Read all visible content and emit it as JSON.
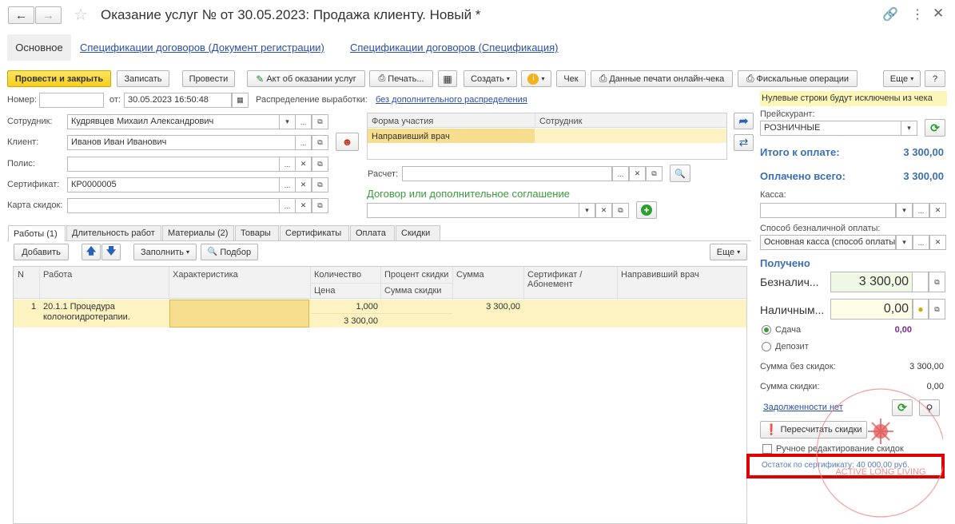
{
  "window": {
    "title": "Оказание услуг №  от 30.05.2023: Продажа клиенту.  Новый *"
  },
  "nav_tabs": {
    "main": "Основное",
    "spec_reg": "Спецификации договоров (Документ регистрации)",
    "spec": "Спецификации договоров (Спецификация)"
  },
  "toolbar": {
    "post_close": "Провести и закрыть",
    "write": "Записать",
    "post": "Провести",
    "act": "Акт об оказании услуг",
    "print": "Печать...",
    "create": "Создать",
    "check": "Чек",
    "online_print": "Данные печати онлайн-чека",
    "fiscal": "Фискальные операции",
    "more": "Еще",
    "help": "?"
  },
  "header": {
    "number_label": "Номер:",
    "number_value": "",
    "date_label": "от:",
    "date_value": "30.05.2023 16:50:48",
    "distribution_label": "Распределение выработки:",
    "distribution_value": "без дополнительного распределения",
    "zero_warning": "Нулевые строки будут исключены из чека"
  },
  "fields": {
    "employee_label": "Сотрудник:",
    "employee_value": "Кудрявцев Михаил Александрович",
    "client_label": "Клиент:",
    "client_value": "Иванов Иван Иванович",
    "policy_label": "Полис:",
    "policy_value": "",
    "certificate_label": "Сертификат:",
    "certificate_value": "КР0000005",
    "discount_card_label": "Карта скидок:",
    "discount_card_value": "",
    "calc_label": "Расчет:",
    "calc_value": "",
    "contract_label": "Договор или дополнительное соглашение",
    "contract_value": ""
  },
  "participation": {
    "col_form": "Форма участия",
    "col_employee": "Сотрудник",
    "row_form": "Направивший врач",
    "row_employee": ""
  },
  "tabs": [
    "Работы (1)",
    "Длительность работ",
    "Материалы (2)",
    "Товары",
    "Сертификаты",
    "Оплата",
    "Скидки"
  ],
  "table_toolbar": {
    "add": "Добавить",
    "fill": "Заполнить",
    "pick": "Подбор",
    "more": "Еще"
  },
  "table": {
    "headers": {
      "n": "N",
      "work": "Работа",
      "characteristic": "Характеристика",
      "qty": "Количество",
      "price": "Цена",
      "discount_pct": "Процент скидки",
      "discount_sum": "Сумма скидки",
      "sum": "Сумма",
      "cert": "Сертификат /",
      "cert2": "Абонемент",
      "doctor": "Направивший врач"
    },
    "rows": [
      {
        "n": "1",
        "work1": "20.1.1 Процедура",
        "work2": "колоногидротерапии.",
        "characteristic": "",
        "qty": "1,000",
        "price": "3 300,00",
        "discount_pct": "",
        "discount_sum": "",
        "sum": "3 300,00",
        "cert": "",
        "doctor": ""
      }
    ]
  },
  "right": {
    "pricelist_label": "Прейскурант:",
    "pricelist_value": "РОЗНИЧНЫЕ",
    "total_label": "Итого к оплате:",
    "total_value": "3 300,00",
    "paid_label": "Оплачено всего:",
    "paid_value": "3 300,00",
    "cashbox_label": "Касса:",
    "cashbox_value": "",
    "noncash_method_label": "Способ безналичной оплаты:",
    "noncash_method_value": "Основная касса (способ оплаты",
    "received_label": "Получено",
    "cashless_label": "Безналич...",
    "cashless_value": "3 300,00",
    "cash_label": "Наличным...",
    "cash_value": "0,00",
    "change_label": "Сдача",
    "change_value": "0,00",
    "deposit_label": "Депозит",
    "sum_no_disc_label": "Сумма без скидок:",
    "sum_no_disc_value": "3 300,00",
    "disc_sum_label": "Сумма скидки:",
    "disc_sum_value": "0,00",
    "no_debts": "Задолженности нет",
    "recalc": "Пересчитать скидки",
    "manual_edit": "Ручное редактирование скидок",
    "cert_balance": "Остаток по сертификату: 40 000,00 руб."
  },
  "watermark": {
    "text": "ACTIVE LONG LIVING"
  },
  "colors": {
    "accent_yellow": "#f6cf1a",
    "row_highlight": "#fdf2c1",
    "link_blue": "#2b4ea8",
    "title_blue": "#3b6fb3",
    "green": "#2e9e2e",
    "annotation_red": "#e00000",
    "purple": "#7a2d8c"
  }
}
